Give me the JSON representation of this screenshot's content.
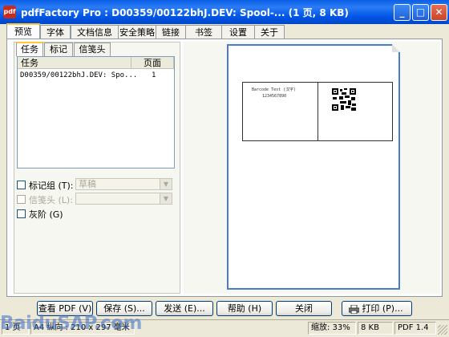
{
  "window": {
    "app_icon_text": "pdf",
    "title": "pdfFactory Pro : D00359/00122bhJ.DEV: Spool-... (1 页, 8 KB)",
    "minimize": "_",
    "maximize": "□",
    "close": "✕"
  },
  "tabs": [
    "预览",
    "字体",
    "文档信息",
    "安全策略",
    "链接",
    "书签",
    "设置",
    "关于"
  ],
  "active_tab": "预览",
  "subtabs": [
    "任务",
    "标记",
    "信笺头"
  ],
  "job_list": {
    "headers": [
      "任务",
      "页面"
    ],
    "rows": [
      {
        "name": "D00359/00122bhJ.DEV: Spo...",
        "pages": "1"
      }
    ]
  },
  "options": {
    "mark_group_label": "标记组 (T):",
    "mark_group_value": "草稿",
    "letterhead_label": "信笺头 (L):",
    "letterhead_value": "",
    "grayscale_label": "灰阶 (G)"
  },
  "preview": {
    "barcode_title": "Barcode Test (汉字)",
    "barcode_number": "1234567890"
  },
  "buttons": {
    "view_pdf": "查看 PDF (V)",
    "save": "保存 (S)...",
    "send": "发送 (E)...",
    "help": "帮助 (H)",
    "close": "关闭",
    "print": "打印 (P)..."
  },
  "status": {
    "page_label": "1 页",
    "paper": "A4 纵向 : 210 x 297 毫米",
    "zoom": "缩放: 33%",
    "size": "8 KB",
    "version": "PDF 1.4"
  },
  "watermark": "BaiduSAP.com",
  "colors": {
    "titlebar": "#0055E5",
    "close_button": "#C8442A",
    "tab_highlight": "#FFC83C",
    "page_border": "#4A7DC9"
  }
}
